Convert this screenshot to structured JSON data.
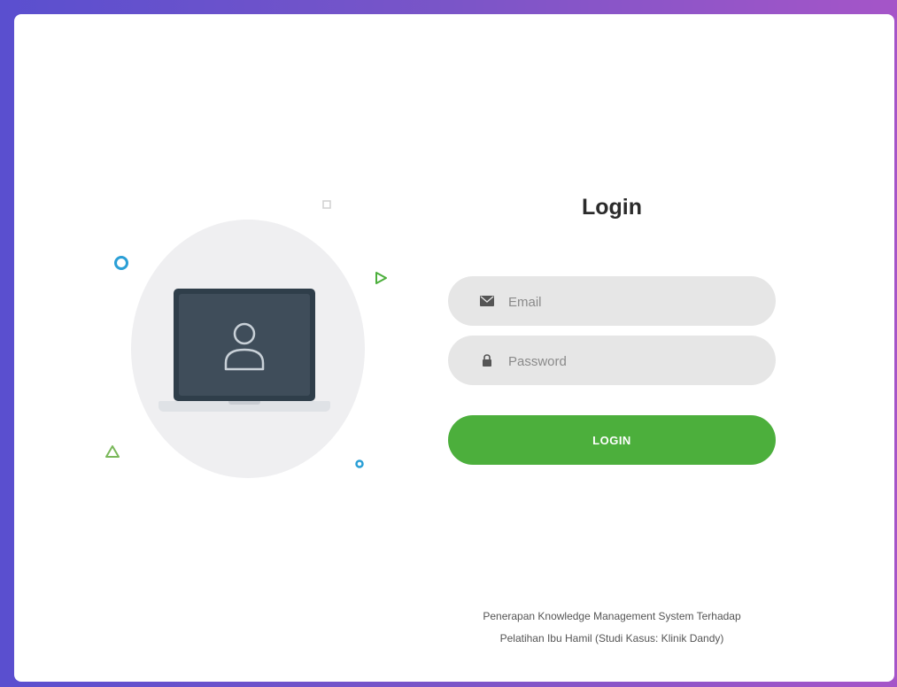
{
  "login": {
    "title": "Login",
    "email_placeholder": "Email",
    "password_placeholder": "Password",
    "button_label": "LOGIN"
  },
  "footer": {
    "line1": "Penerapan Knowledge Management System Terhadap",
    "line2": "Pelatihan Ibu Hamil (Studi Kasus: Klinik Dandy)"
  },
  "icons": {
    "email": "envelope-icon",
    "password": "lock-icon",
    "illustration": "laptop-user-icon"
  },
  "colors": {
    "accent": "#4caf3c",
    "field_bg": "#e6e6e6",
    "background_start": "#5a4fcf",
    "background_end": "#a555c8",
    "screen": "#2f3e4a"
  }
}
